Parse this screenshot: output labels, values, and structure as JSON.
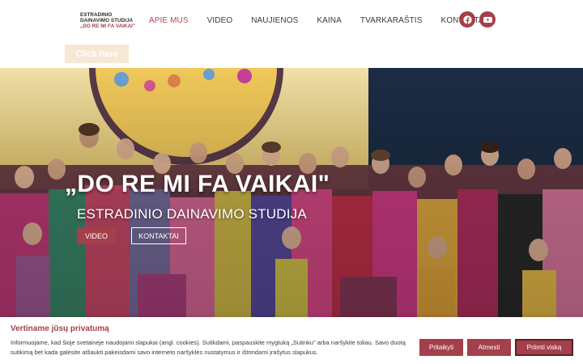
{
  "brand": {
    "line1": "ESTRADINIO",
    "line2": "DAINAVIMO STUDIJA",
    "line3": "„DO RE MI FA VAIKAI\""
  },
  "nav": {
    "items": [
      {
        "label": "APIE MUS"
      },
      {
        "label": "VIDEO"
      },
      {
        "label": "NAUJIENOS"
      },
      {
        "label": "KAINA"
      },
      {
        "label": "TVARKARAŠTIS"
      },
      {
        "label": "KONTAKTAI"
      }
    ],
    "active_color": "#b24a52"
  },
  "social": {
    "facebook_icon": "facebook-icon",
    "youtube_icon": "youtube-icon"
  },
  "click_button": {
    "label": "Click here"
  },
  "hero": {
    "title": "„DO RE MI FA VAIKAI\"",
    "subtitle": "ESTRADINIO DAINAVIMO STUDIJA",
    "video_button": "VIDEO",
    "contact_button": "KONTAKTAI"
  },
  "cookie": {
    "title": "Vertiname jūsų privatumą",
    "text": "Informuojame, kad šioje svetainėje naudojami slapukai (angl. cookies). Sutikdami, paspauskite mygtuką „Sutinku\" arba naršykite toliau. Savo duotą sutikimą bet kada galėsite atšaukti pakeisdami savo interneto naršyklės nustatymus ir ištrindami įrašytus slapukus.",
    "customize_label": "Pritaikyti",
    "reject_label": "Atmesti",
    "accept_label": "Priimti viską"
  },
  "colors": {
    "accent": "#a3404a",
    "accent_dark": "#5c1f26",
    "click_button_bg": "#f7e8d5"
  }
}
